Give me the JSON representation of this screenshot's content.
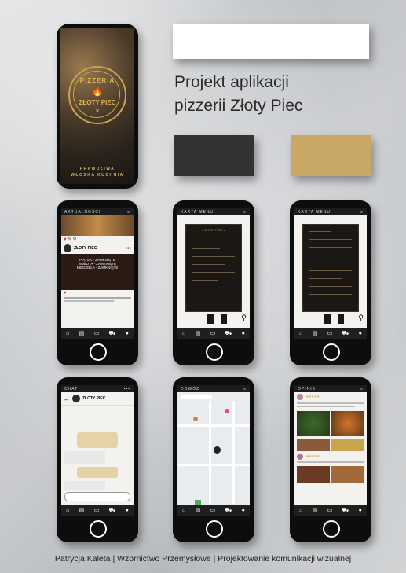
{
  "poster": {
    "title_line1": "Projekt aplikacji",
    "title_line2": "pizzerii Złoty Piec",
    "footer": "Patrycja Kaleta | Wzornictwo Przemysłowe | Projektowanie  komunikacji wizualnej"
  },
  "palette": {
    "white": "#ffffff",
    "dark": "#333333",
    "gold": "#c9a866"
  },
  "hero": {
    "logo_top": "PIZZERIA",
    "logo_bottom": "ZŁOTY PIEC",
    "tagline_1": "PRAWDZIWA",
    "tagline_2": "WŁOSKA KUCHNIA"
  },
  "screens": {
    "news": {
      "header": "AKTUALNOŚCI",
      "post_name": "ZŁOTY PIEC",
      "notice_lines": [
        "PIĄTEK - ZAMKNIĘTE",
        "SOBOTA - ZAMKNIĘTE",
        "NIEDZIELA - ZAMKNIĘTE"
      ]
    },
    "menu1": {
      "header": "KARTA MENU"
    },
    "menu2": {
      "header": "KARTA MENU"
    },
    "chat": {
      "header": "CHAT",
      "contact": "ZŁOTY PIEC"
    },
    "delivery": {
      "header": "DOWÓZ"
    },
    "reviews": {
      "header": "OPINIE"
    }
  },
  "nav_icons": [
    "home-icon",
    "menu-icon",
    "chat-icon",
    "delivery-icon",
    "reviews-icon"
  ]
}
